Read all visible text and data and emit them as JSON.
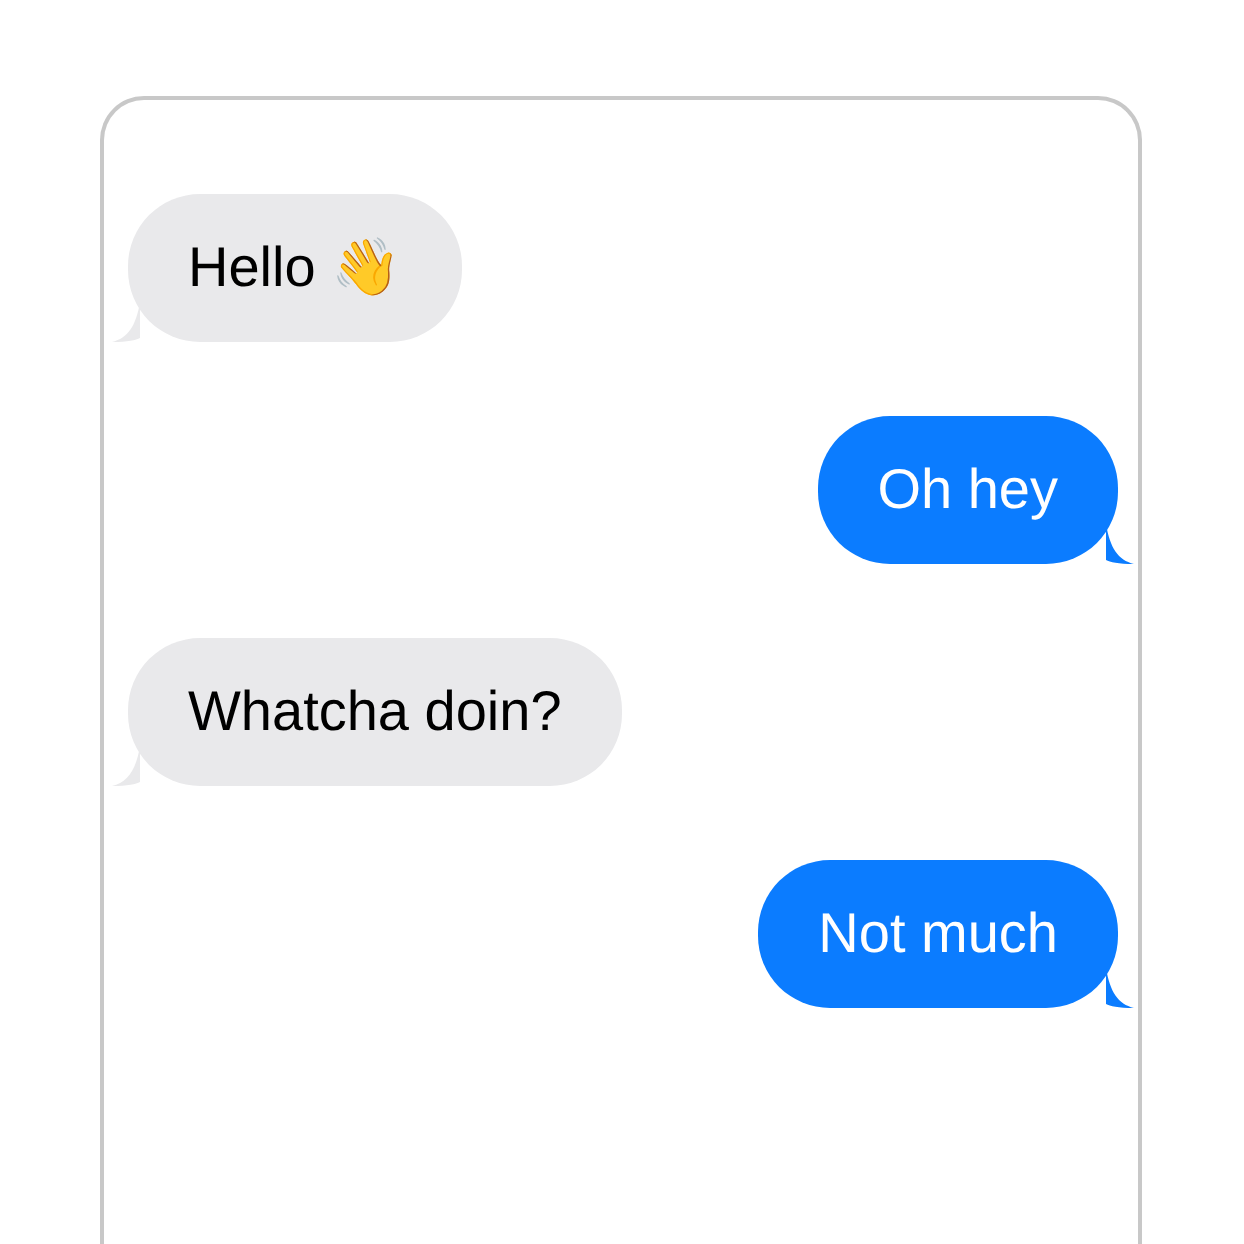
{
  "messages": [
    {
      "kind": "received",
      "text": "Hello 👋"
    },
    {
      "kind": "sent",
      "text": "Oh hey"
    },
    {
      "kind": "received",
      "text": "Whatcha doin?"
    },
    {
      "kind": "sent",
      "text": "Not much"
    }
  ]
}
